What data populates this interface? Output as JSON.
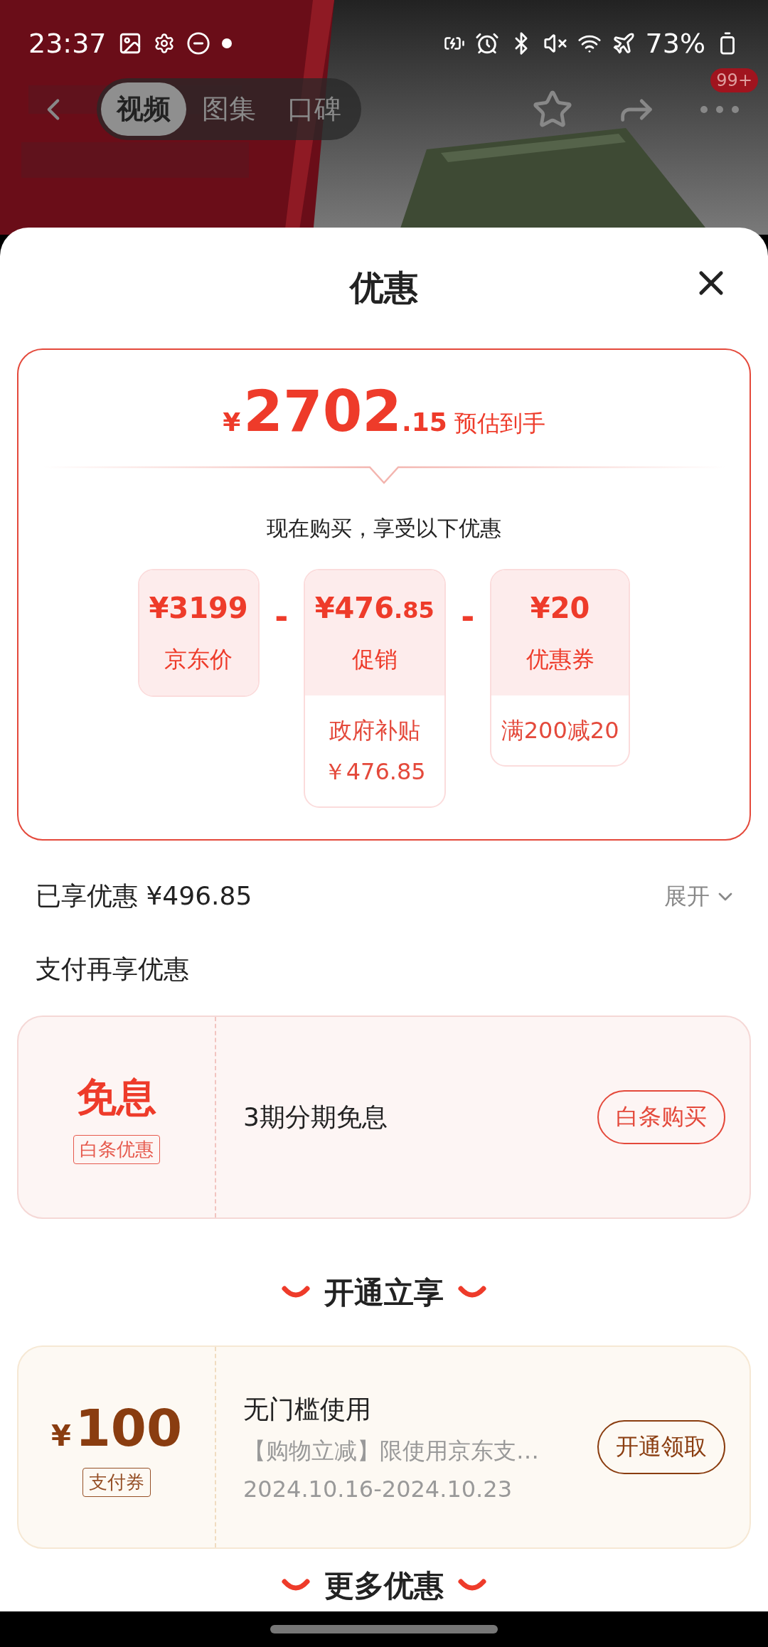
{
  "status_bar": {
    "time": "23:37",
    "battery": "73%"
  },
  "header": {
    "tabs": [
      {
        "label": "视频",
        "selected": true
      },
      {
        "label": "图集",
        "selected": false
      },
      {
        "label": "口碑",
        "selected": false
      }
    ],
    "badge": "99+"
  },
  "sheet": {
    "title": "优惠",
    "estimate": {
      "currency": "¥",
      "integer": "2702",
      "decimal": ".15",
      "label": "预估到手"
    },
    "subtitle": "现在购买，享受以下优惠",
    "breakdown": [
      {
        "amount": "¥3199",
        "label": "京东价"
      },
      {
        "operator": "-",
        "amount": "¥476",
        "cents": ".85",
        "label": "促销",
        "details": [
          "政府补贴",
          "￥476.85"
        ]
      },
      {
        "operator": "-",
        "amount": "¥20",
        "label": "优惠券",
        "details": [
          "满200减20"
        ]
      }
    ],
    "saved": {
      "label": "已享优惠 ¥496.85",
      "toggle": "展开"
    },
    "pay_title": "支付再享优惠",
    "pay_offer": {
      "kind": "baitiao",
      "headline": "免息",
      "tag": "白条优惠",
      "title": "3期分期免息",
      "button": "白条购买"
    },
    "open_section": {
      "title": "开通立享",
      "coupon": {
        "kind": "coupon",
        "currency": "¥",
        "headline": "100",
        "tag": "支付券",
        "title": "无门槛使用",
        "desc": "【购物立减】限使用京东支…",
        "dates": "2024.10.16-2024.10.23",
        "button": "开通领取"
      }
    },
    "more_title": "更多优惠"
  }
}
